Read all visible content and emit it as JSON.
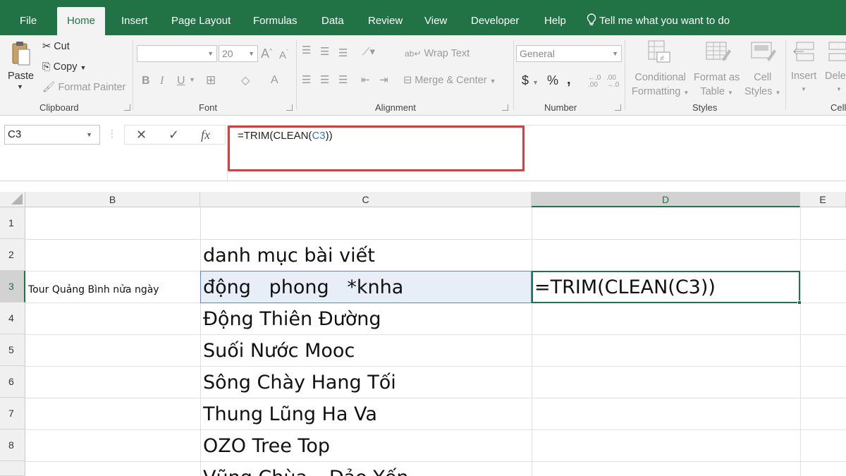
{
  "tabs": [
    {
      "label": "File"
    },
    {
      "label": "Home",
      "active": true
    },
    {
      "label": "Insert"
    },
    {
      "label": "Page Layout"
    },
    {
      "label": "Formulas"
    },
    {
      "label": "Data"
    },
    {
      "label": "Review"
    },
    {
      "label": "View"
    },
    {
      "label": "Developer"
    },
    {
      "label": "Help"
    }
  ],
  "tell_me": "Tell me what you want to do",
  "ribbon": {
    "clipboard": {
      "paste": "Paste",
      "cut": "Cut",
      "copy": "Copy",
      "format_painter": "Format Painter",
      "group_label": "Clipboard"
    },
    "font": {
      "font_name": "",
      "font_size": "20",
      "bold": "B",
      "italic": "I",
      "underline": "U",
      "grow": "A",
      "shrink": "A",
      "font_color": "A",
      "group_label": "Font"
    },
    "alignment": {
      "wrap_text": "Wrap Text",
      "merge_center": "Merge & Center",
      "group_label": "Alignment"
    },
    "number": {
      "format": "General",
      "currency": "$",
      "percent": "%",
      "comma": ",",
      "group_label": "Number"
    },
    "styles": {
      "conditional": [
        "Conditional",
        "Formatting"
      ],
      "format_table": [
        "Format as",
        "Table"
      ],
      "cell_styles": [
        "Cell",
        "Styles"
      ],
      "group_label": "Styles"
    },
    "cells": {
      "insert": "Insert",
      "delete": "Dele",
      "group_label": "Cell"
    }
  },
  "formula_bar": {
    "name_box": "C3",
    "cancel": "✕",
    "enter": "✓",
    "fx": "fx",
    "formula_before": "=TRIM(CLEAN(",
    "formula_ref": "C3",
    "formula_after": "))"
  },
  "grid": {
    "columns": [
      "B",
      "C",
      "D",
      "E"
    ],
    "selected_column": "D",
    "rows": [
      "1",
      "2",
      "3",
      "4",
      "5",
      "6",
      "7",
      "8",
      ""
    ],
    "selected_row": "3",
    "cells": {
      "B3": "Tour Quảng Bình nửa ngày",
      "C2": "danh mục bài viết",
      "C3": "động   phong   *knha",
      "C4": "Động Thiên Đường",
      "C5": "Suối Nước Mooc",
      "C6": "Sông Chày Hang Tối",
      "C7": "Thung Lũng Ha Va",
      "C8": "OZO Tree Top",
      "C9": "Vũng Chùa – Đảo Yến",
      "D3": "=TRIM(CLEAN(C3))"
    }
  },
  "colors": {
    "excel_green": "#217346",
    "highlight_red": "#e23a3a",
    "ref_blue": "#3a6fd1"
  }
}
